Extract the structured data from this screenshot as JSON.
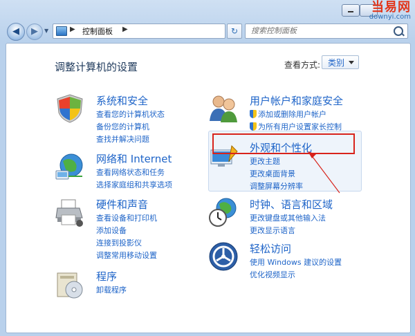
{
  "watermark": {
    "cn": "当易网",
    "en": "downyi.com"
  },
  "nav": {
    "back_glyph": "◀",
    "forward_glyph": "▶"
  },
  "address": {
    "crumb": "控制面板",
    "sep": "▶"
  },
  "search": {
    "placeholder": "搜索控制面板"
  },
  "page": {
    "title": "调整计算机的设置",
    "view_by_label": "查看方式:",
    "view_by_value": "类别"
  },
  "categories": [
    {
      "name": "系统和安全",
      "links": [
        "查看您的计算机状态",
        "备份您的计算机",
        "查找并解决问题"
      ]
    },
    {
      "name": "网络和 Internet",
      "links": [
        "查看网络状态和任务",
        "选择家庭组和共享选项"
      ]
    },
    {
      "name": "硬件和声音",
      "links": [
        "查看设备和打印机",
        "添加设备",
        "连接到投影仪",
        "调整常用移动设置"
      ]
    },
    {
      "name": "程序",
      "links": [
        "卸载程序"
      ]
    },
    {
      "name": "用户帐户和家庭安全",
      "links": [
        "添加或删除用户帐户",
        "为所有用户设置家长控制"
      ]
    },
    {
      "name": "外观和个性化",
      "links": [
        "更改主题",
        "更改桌面背景",
        "调整屏幕分辨率"
      ]
    },
    {
      "name": "时钟、语言和区域",
      "links": [
        "更改键盘或其他输入法",
        "更改显示语言"
      ]
    },
    {
      "name": "轻松访问",
      "links": [
        "使用 Windows 建议的设置",
        "优化视频显示"
      ]
    }
  ],
  "colors": {
    "link": "#1e64c8",
    "highlight_red": "#d8231b",
    "title": "#1e395b"
  }
}
